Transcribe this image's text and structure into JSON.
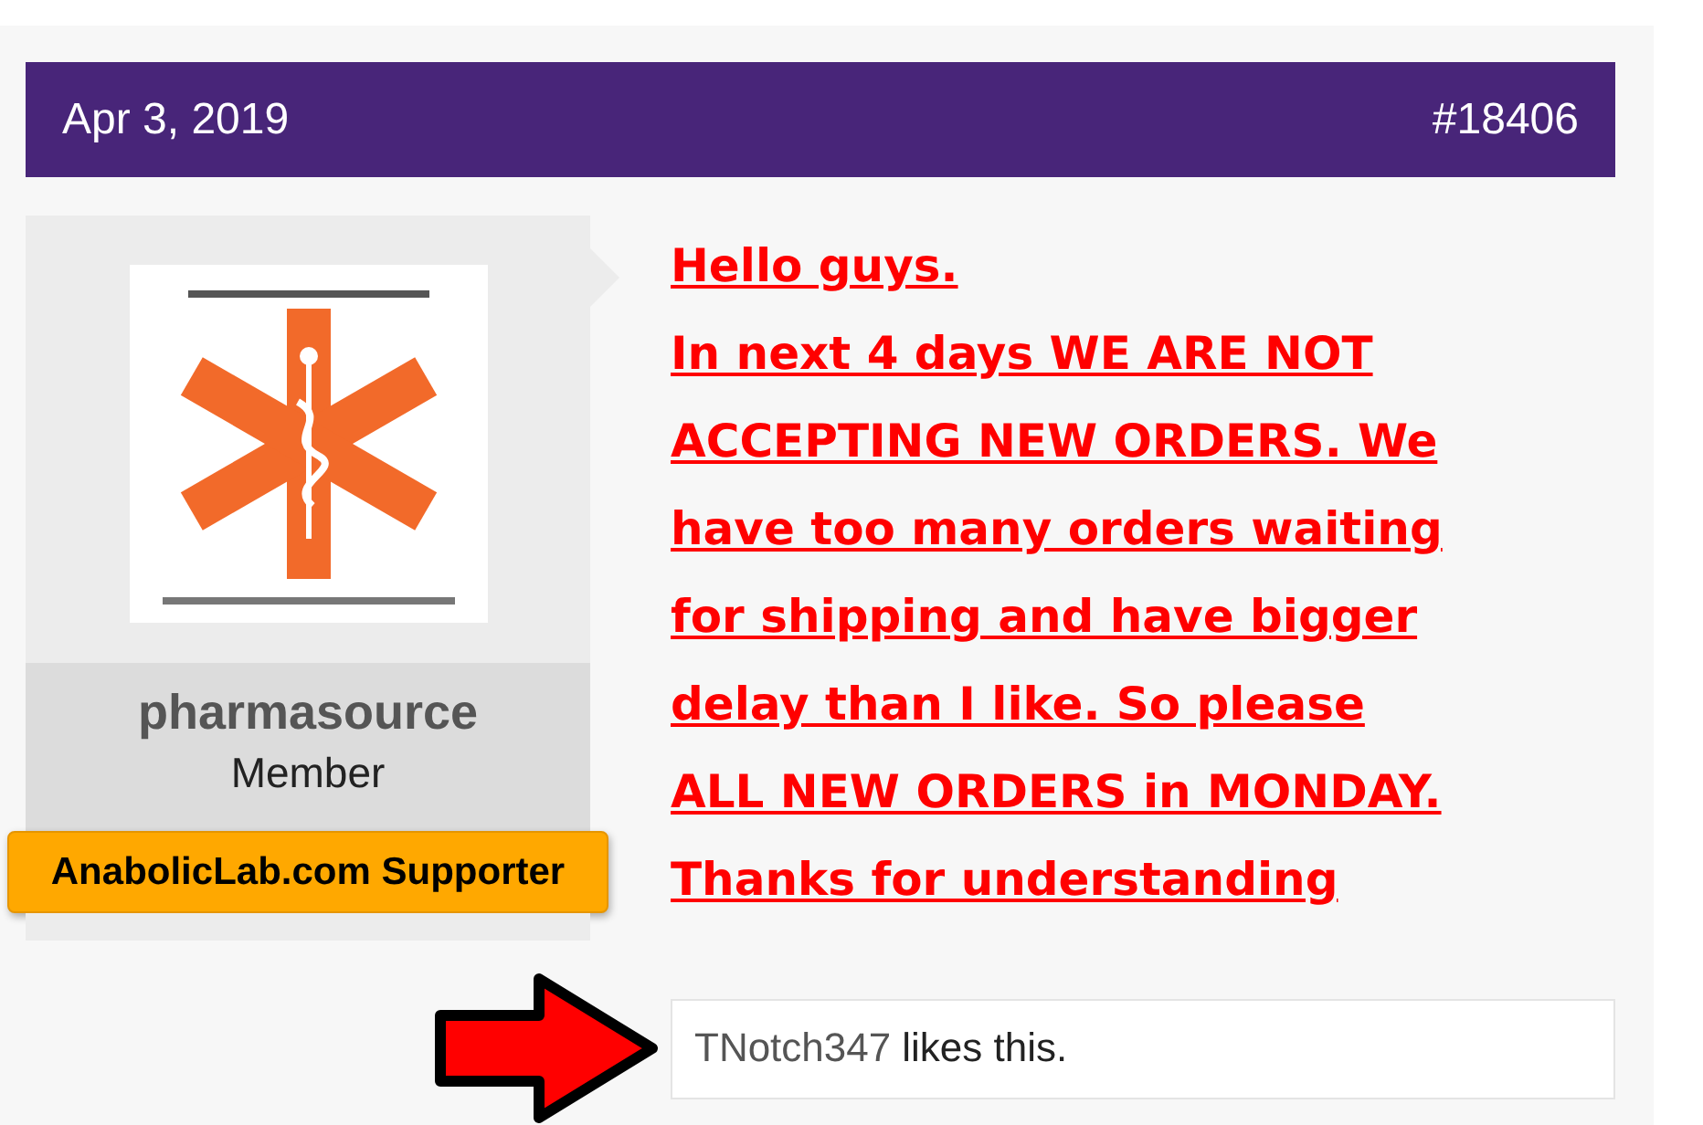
{
  "post": {
    "date": "Apr 3, 2019",
    "number": "#18406"
  },
  "author": {
    "username": "pharmasource",
    "role": "Member",
    "banner": "AnabolicLab.com Supporter"
  },
  "message": {
    "lines": [
      "Hello guys.",
      "In next 4 days WE ARE NOT",
      "ACCEPTING NEW ORDERS. We",
      "have too many orders waiting",
      "for shipping and have bigger",
      "delay than I like. So please",
      "ALL NEW ORDERS in MONDAY.",
      "Thanks for understanding"
    ]
  },
  "likes": {
    "user": "TNotch347",
    "text": "likes this."
  }
}
